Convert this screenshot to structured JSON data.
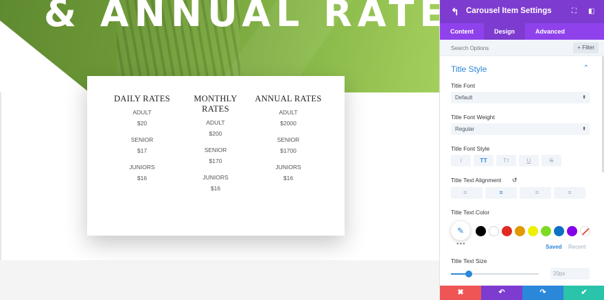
{
  "hero": {
    "title": "& ANNUAL RATES"
  },
  "rates": [
    {
      "heading": "DAILY RATES",
      "items": [
        {
          "label": "ADULT",
          "price": "$20"
        },
        {
          "label": "SENIOR",
          "price": "$17"
        },
        {
          "label": "JUNIORS",
          "price": "$16"
        }
      ]
    },
    {
      "heading": "MONTHLY RATES",
      "items": [
        {
          "label": "ADULT",
          "price": "$200"
        },
        {
          "label": "SENIOR",
          "price": "$170"
        },
        {
          "label": "JUNIORS",
          "price": "$16"
        }
      ]
    },
    {
      "heading": "ANNUAL RATES",
      "items": [
        {
          "label": "ADULT",
          "price": "$2000"
        },
        {
          "label": "SENIOR",
          "price": "$1700"
        },
        {
          "label": "JUNIORS",
          "price": "$16"
        }
      ]
    }
  ],
  "panel": {
    "back_icon": "↰",
    "title": "Carousel Item Settings",
    "expand_icon": "⛶",
    "layout_icon": "◧",
    "tabs": [
      {
        "label": "Content",
        "active": false
      },
      {
        "label": "Design",
        "active": true
      },
      {
        "label": "Advanced",
        "active": false
      }
    ],
    "search_placeholder": "Search Options",
    "filter_label": "+ Filter",
    "section_title": "Title Style",
    "collapse_icon": "⌃",
    "title_font": {
      "label": "Title Font",
      "value": "Default"
    },
    "title_font_weight": {
      "label": "Title Font Weight",
      "value": "Regular"
    },
    "select_arrow": "⬍",
    "font_style": {
      "label": "Title Font Style",
      "buttons": [
        {
          "glyph": "I",
          "name": "italic",
          "active": false
        },
        {
          "glyph": "TT",
          "name": "uppercase",
          "active": true
        },
        {
          "glyph": "Tт",
          "name": "capitalize",
          "active": false
        },
        {
          "glyph": "U",
          "name": "underline",
          "active": false
        },
        {
          "glyph": "S",
          "name": "strikethrough",
          "active": false
        }
      ]
    },
    "text_alignment": {
      "label": "Title Text Alignment",
      "reset_icon": "↺",
      "buttons": [
        {
          "glyph": "≡",
          "name": "left",
          "active": false
        },
        {
          "glyph": "≡",
          "name": "center",
          "active": true
        },
        {
          "glyph": "≡",
          "name": "right",
          "active": false
        },
        {
          "glyph": "≡",
          "name": "justify",
          "active": false
        }
      ]
    },
    "text_color": {
      "label": "Title Text Color",
      "picker_icon": "✎",
      "more_icon": "•••",
      "swatches": [
        "#000000",
        "#ffffff",
        "#e02b20",
        "#e09900",
        "#edf000",
        "#7cda24",
        "#0c71c3",
        "#8300e9"
      ],
      "saved_label": "Saved",
      "recent_label": "Recent"
    },
    "text_size": {
      "label": "Title Text Size",
      "value": "20px",
      "slider_fraction": 0.2
    },
    "footer": {
      "cancel_icon": "✖",
      "undo_icon": "↶",
      "redo_icon": "↷",
      "save_icon": "✔"
    }
  }
}
